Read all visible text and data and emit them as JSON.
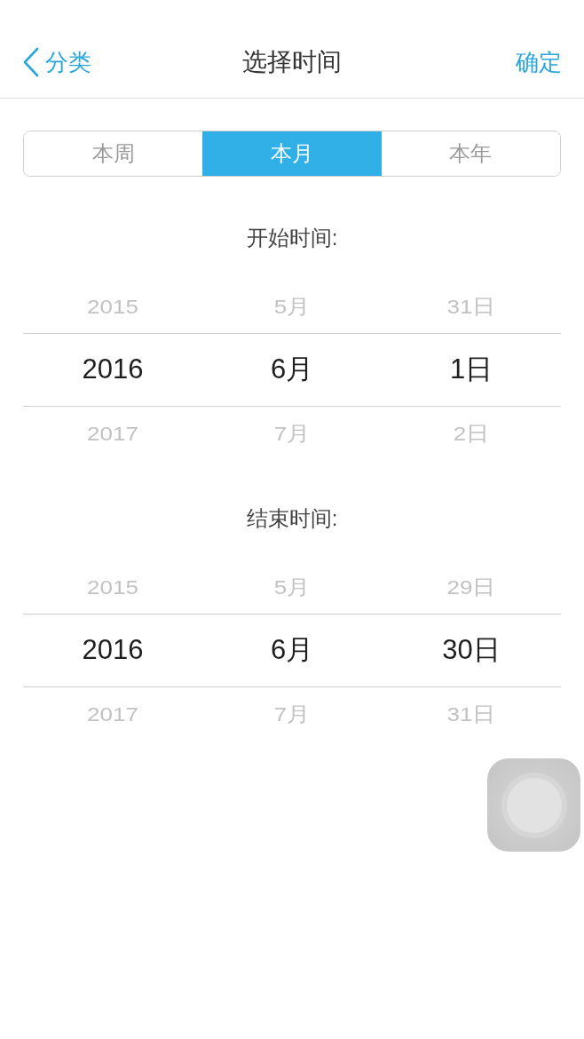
{
  "nav_bar": {
    "back_label": "分类",
    "title": "选择时间",
    "confirm_label": "确定"
  },
  "segments": [
    {
      "label": "本周",
      "selected": false
    },
    {
      "label": "本月",
      "selected": true
    },
    {
      "label": "本年",
      "selected": false
    }
  ],
  "pickers": [
    {
      "label": "开始时间:",
      "columns": [
        {
          "items": [
            {
              "text": "2015",
              "selected": false
            },
            {
              "text": "2016",
              "selected": true
            },
            {
              "text": "2017",
              "selected": false
            }
          ]
        },
        {
          "items": [
            {
              "text": "5月",
              "selected": false
            },
            {
              "text": "6月",
              "selected": true
            },
            {
              "text": "7月",
              "selected": false
            }
          ]
        },
        {
          "items": [
            {
              "text": "31日",
              "selected": false
            },
            {
              "text": "1日",
              "selected": true
            },
            {
              "text": "2日",
              "selected": false
            }
          ]
        }
      ]
    },
    {
      "label": "结束时间:",
      "columns": [
        {
          "items": [
            {
              "text": "2015",
              "selected": false
            },
            {
              "text": "2016",
              "selected": true
            },
            {
              "text": "2017",
              "selected": false
            }
          ]
        },
        {
          "items": [
            {
              "text": "5月",
              "selected": false
            },
            {
              "text": "6月",
              "selected": true
            },
            {
              "text": "7月",
              "selected": false
            }
          ]
        },
        {
          "items": [
            {
              "text": "29日",
              "selected": false
            },
            {
              "text": "30日",
              "selected": true
            },
            {
              "text": "31日",
              "selected": false
            }
          ]
        }
      ]
    }
  ]
}
